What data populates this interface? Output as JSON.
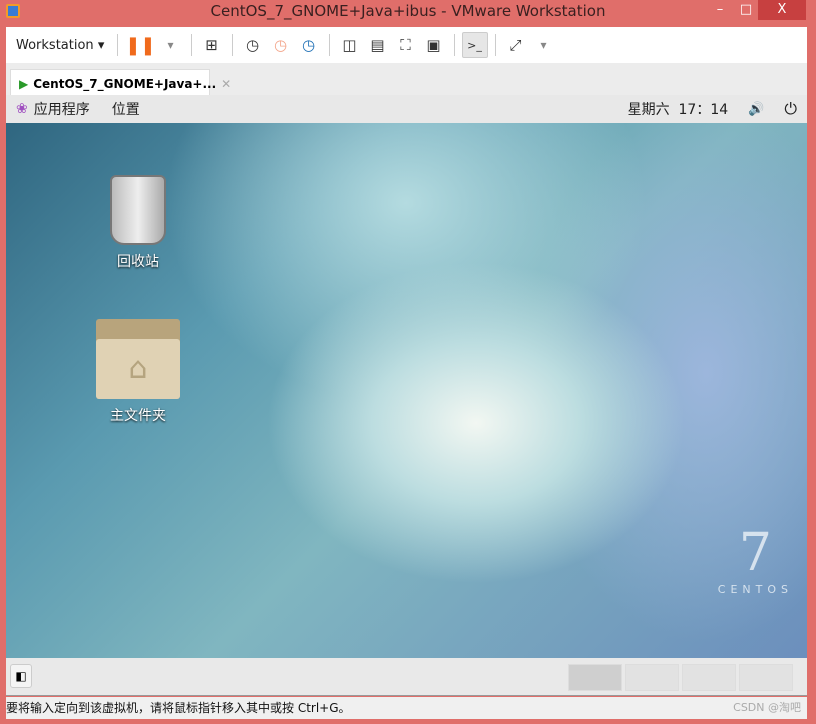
{
  "window": {
    "title": "CentOS_7_GNOME+Java+ibus - VMware Workstation",
    "minimize": "–",
    "maximize": "□",
    "close": "X"
  },
  "toolbar": {
    "workstation_label": "Workstation",
    "dropdown": "▾",
    "pause_color": "#f06a1c"
  },
  "tab": {
    "label": "CentOS_7_GNOME+Java+...",
    "close": "✕"
  },
  "gnome_bar": {
    "applications": "应用程序",
    "places": "位置",
    "clock": "星期六  17：14",
    "volume": "🔊",
    "power": "⏻"
  },
  "desktop": {
    "icons": [
      {
        "label": "回收站"
      },
      {
        "label": "主文件夹"
      }
    ],
    "logo_number": "7",
    "logo_text": "CENTOS"
  },
  "status": {
    "message": "要将输入定向到该虚拟机，请将鼠标指针移入其中或按 Ctrl+G。",
    "watermark": "CSDN @淘吧"
  }
}
